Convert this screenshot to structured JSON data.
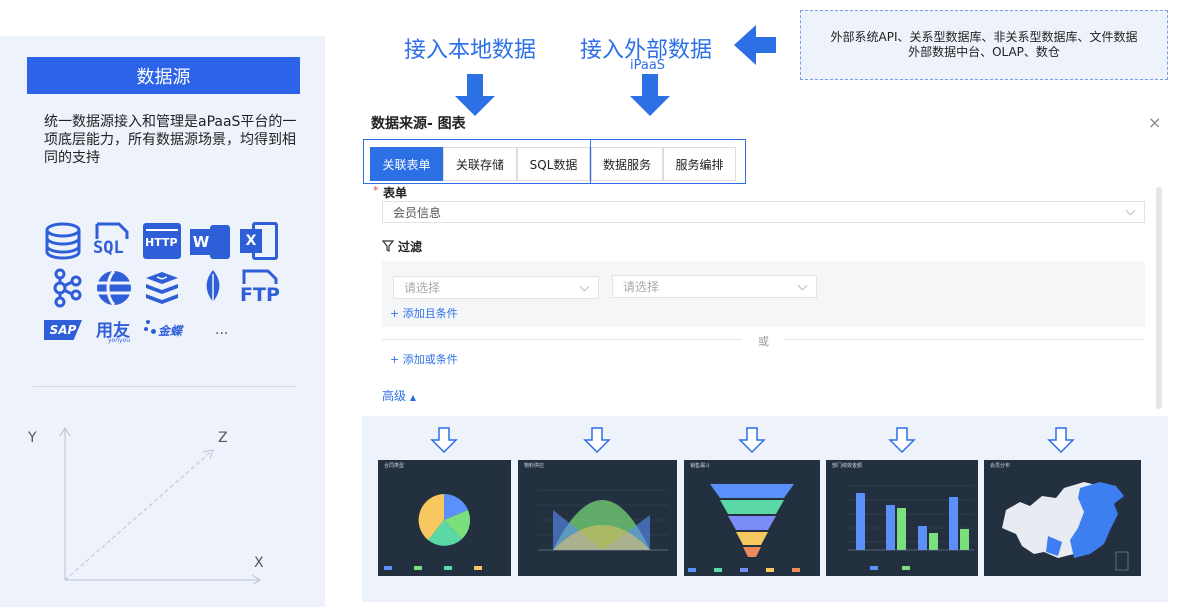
{
  "left_panel": {
    "title": "数据源",
    "description": "统一数据源接入和管理是aPaaS平台的一项底层能力，所有数据源场景，均得到相同的支持",
    "icons_row1": [
      "database-icon",
      "sql-icon",
      "http-icon",
      "word-icon",
      "excel-icon"
    ],
    "sql_text": "SQL",
    "http_text": "HTTP",
    "word_text": "W",
    "excel_text": "X",
    "icons_row2": [
      "kafka-icon",
      "globe-icon",
      "redis-icon",
      "mongodb-icon",
      "ftp-icon"
    ],
    "ftp_text": "FTP",
    "sap_text": "SAP",
    "yonyou_text": "用友",
    "yonyou_sub": "yonyou",
    "kingdee_text": "金蝶",
    "more_text": "...",
    "axis": {
      "y": "Y",
      "z": "Z",
      "x": "X"
    }
  },
  "header": {
    "local_title": "接入本地数据",
    "external_title": "接入外部数据",
    "ipaas": "iPaaS",
    "external_sources_line1": "外部系统API、关系型数据库、非关系型数据库、文件数据",
    "external_sources_line2": "外部数据中台、OLAP、数仓"
  },
  "dialog": {
    "title": "数据来源- 图表",
    "close": "×",
    "tabs": [
      "关联表单",
      "关联存储",
      "SQL数据",
      "数据服务",
      "服务编排"
    ],
    "form_required": "*",
    "form_label": "表单",
    "form_value": "会员信息",
    "filter_label": "过滤",
    "select1_placeholder": "请选择",
    "select2_placeholder": "请选择",
    "add_and": "+ 添加且条件",
    "or_text": "或",
    "add_or": "+ 添加或条件",
    "advanced": "高级"
  },
  "charts": {
    "pie_title": "合同类型",
    "area_title": "物料供应",
    "funnel_title": "销售漏斗",
    "bar_title": "部门绩效金额",
    "map_title": "会员分布"
  },
  "colors": {
    "accent": "#2d70e6",
    "brand": "#2d63e8",
    "panel": "#eef2fb",
    "chart_bg": "#22303f"
  }
}
